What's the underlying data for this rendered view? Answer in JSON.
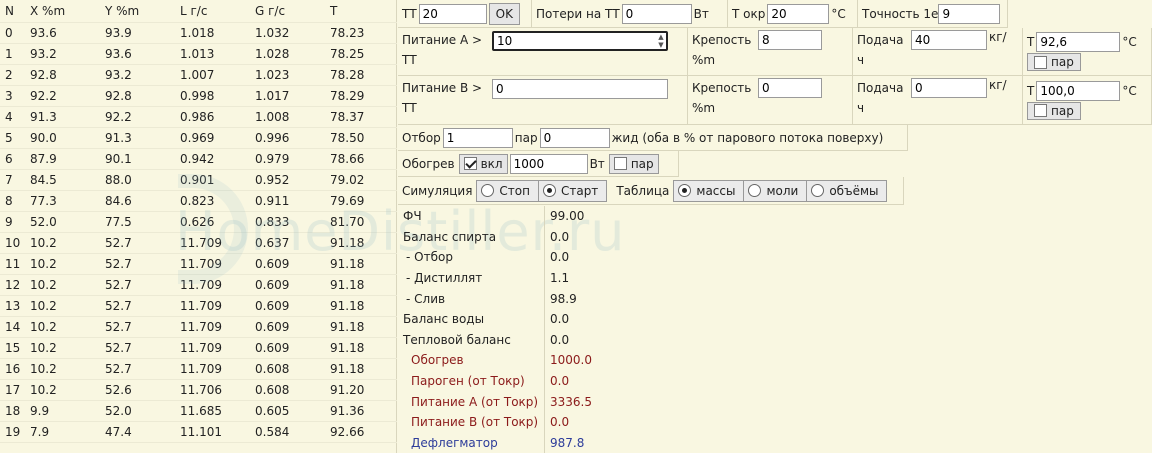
{
  "table": {
    "headers": [
      "N",
      "X %m",
      "Y %m",
      "L г/с",
      "G г/с",
      "T"
    ],
    "rows": [
      [
        "0",
        "93.6",
        "93.9",
        "1.018",
        "1.032",
        "78.23"
      ],
      [
        "1",
        "93.2",
        "93.6",
        "1.013",
        "1.028",
        "78.25"
      ],
      [
        "2",
        "92.8",
        "93.2",
        "1.007",
        "1.023",
        "78.28"
      ],
      [
        "3",
        "92.2",
        "92.8",
        "0.998",
        "1.017",
        "78.29"
      ],
      [
        "4",
        "91.3",
        "92.2",
        "0.986",
        "1.008",
        "78.37"
      ],
      [
        "5",
        "90.0",
        "91.3",
        "0.969",
        "0.996",
        "78.50"
      ],
      [
        "6",
        "87.9",
        "90.1",
        "0.942",
        "0.979",
        "78.66"
      ],
      [
        "7",
        "84.5",
        "88.0",
        "0.901",
        "0.952",
        "79.02"
      ],
      [
        "8",
        "77.3",
        "84.6",
        "0.823",
        "0.911",
        "79.69"
      ],
      [
        "9",
        "52.0",
        "77.5",
        "0.626",
        "0.833",
        "81.70"
      ],
      [
        "10",
        "10.2",
        "52.7",
        "11.709",
        "0.637",
        "91.18"
      ],
      [
        "11",
        "10.2",
        "52.7",
        "11.709",
        "0.609",
        "91.18"
      ],
      [
        "12",
        "10.2",
        "52.7",
        "11.709",
        "0.609",
        "91.18"
      ],
      [
        "13",
        "10.2",
        "52.7",
        "11.709",
        "0.609",
        "91.18"
      ],
      [
        "14",
        "10.2",
        "52.7",
        "11.709",
        "0.609",
        "91.18"
      ],
      [
        "15",
        "10.2",
        "52.7",
        "11.709",
        "0.609",
        "91.18"
      ],
      [
        "16",
        "10.2",
        "52.7",
        "11.709",
        "0.608",
        "91.18"
      ],
      [
        "17",
        "10.2",
        "52.6",
        "11.706",
        "0.608",
        "91.20"
      ],
      [
        "18",
        "9.9",
        "52.0",
        "11.685",
        "0.605",
        "91.36"
      ],
      [
        "19",
        "7.9",
        "47.4",
        "11.101",
        "0.584",
        "92.66"
      ]
    ]
  },
  "watermark": "HomeDistiller.ru",
  "top": {
    "tt_label": "ТТ",
    "tt_value": "20",
    "ok_label": "OK",
    "loss_label": "Потери на ТТ",
    "loss_value": "0",
    "loss_unit": "Вт",
    "tenv_label": "Т окр",
    "tenv_value": "20",
    "tenv_unit": "°C",
    "prec_label": "Точность 1е",
    "prec_value": "9"
  },
  "feedA": {
    "label1": "Питание A >",
    "value": "10",
    "label2": "ТТ",
    "strength_label1": "Крепость",
    "strength_value": "8",
    "strength_label2": "%m",
    "flow_label1": "Подача",
    "flow_value": "40",
    "flow_unit": "кг/",
    "flow_label2": "ч",
    "t_label": "Т",
    "t_value": "92,6",
    "t_unit": "°C",
    "steam_label": "пар"
  },
  "feedB": {
    "label1": "Питание B >",
    "value": "0",
    "label2": "ТТ",
    "strength_label1": "Крепость",
    "strength_value": "0",
    "strength_label2": "%m",
    "flow_label1": "Подача",
    "flow_value": "0",
    "flow_unit": "кг/",
    "flow_label2": "ч",
    "t_label": "Т",
    "t_value": "100,0",
    "t_unit": "°C",
    "steam_label": "пар"
  },
  "draw": {
    "label": "Отбор",
    "value": "1",
    "steam_label": "пар",
    "steam_value": "0",
    "liquid_label": "жид (оба в % от парового потока поверху)"
  },
  "heat": {
    "label": "Обогрев",
    "on_label": "вкл",
    "value": "1000",
    "unit": "Вт",
    "steam_label": "пар"
  },
  "sim": {
    "label": "Симуляция",
    "stop_label": "Стоп",
    "start_label": "Старт",
    "table_label": "Таблица",
    "mass_label": "массы",
    "mol_label": "моли",
    "vol_label": "объёмы"
  },
  "results": [
    {
      "k": "ФЧ",
      "v": "99.00"
    },
    {
      "k": "Баланс спирта",
      "v": "0.0"
    },
    {
      "k": " - Отбор",
      "v": "0.0"
    },
    {
      "k": " - Дистиллят",
      "v": "1.1"
    },
    {
      "k": " - Слив",
      "v": "98.9"
    },
    {
      "k": "Баланс воды",
      "v": "0.0"
    },
    {
      "k": "Тепловой баланс",
      "v": "0.0"
    },
    {
      "k": "Обогрев",
      "v": "1000.0"
    },
    {
      "k": "Пароген (от Токр)",
      "v": "0.0"
    },
    {
      "k": "Питание А (от Токр)",
      "v": "3336.5"
    },
    {
      "k": "Питание B (от Токр)",
      "v": "0.0"
    },
    {
      "k": "Дефлегматор",
      "v": "987.8"
    }
  ],
  "colors": {
    "background": "#f9f7e1",
    "accent_red": "#8b1a1a",
    "accent_blue": "#2d3c9a"
  }
}
